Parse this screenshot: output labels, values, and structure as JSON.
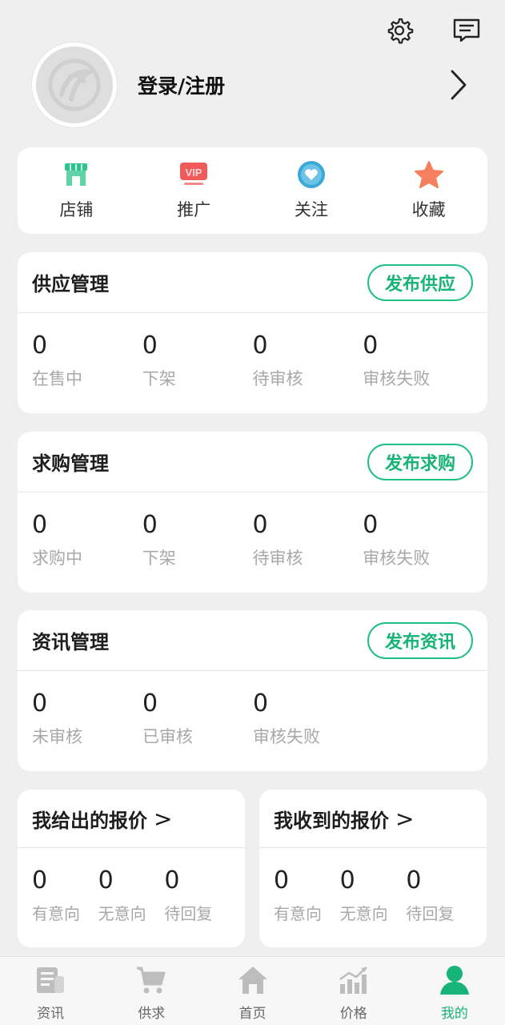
{
  "header": {
    "settings_icon": "gear-icon",
    "message_icon": "message-icon",
    "login_label": "登录/注册"
  },
  "quick_actions": [
    {
      "label": "店铺",
      "icon": "store-icon",
      "color": "#2dc48d"
    },
    {
      "label": "推广",
      "icon": "vip-icon",
      "color": "#f05a5a"
    },
    {
      "label": "关注",
      "icon": "heart-icon",
      "color": "#3aa9d8"
    },
    {
      "label": "收藏",
      "icon": "star-icon",
      "color": "#f4805f"
    }
  ],
  "supply": {
    "title": "供应管理",
    "button": "发布供应",
    "stats": [
      {
        "value": "0",
        "label": "在售中"
      },
      {
        "value": "0",
        "label": "下架"
      },
      {
        "value": "0",
        "label": "待审核"
      },
      {
        "value": "0",
        "label": "审核失败"
      }
    ]
  },
  "demand": {
    "title": "求购管理",
    "button": "发布求购",
    "stats": [
      {
        "value": "0",
        "label": "求购中"
      },
      {
        "value": "0",
        "label": "下架"
      },
      {
        "value": "0",
        "label": "待审核"
      },
      {
        "value": "0",
        "label": "审核失败"
      }
    ]
  },
  "news": {
    "title": "资讯管理",
    "button": "发布资讯",
    "stats": [
      {
        "value": "0",
        "label": "未审核"
      },
      {
        "value": "0",
        "label": "已审核"
      },
      {
        "value": "0",
        "label": "审核失败"
      }
    ]
  },
  "quotes_given": {
    "title": "我给出的报价",
    "arrow": ">",
    "stats": [
      {
        "value": "0",
        "label": "有意向"
      },
      {
        "value": "0",
        "label": "无意向"
      },
      {
        "value": "0",
        "label": "待回复"
      }
    ]
  },
  "quotes_received": {
    "title": "我收到的报价",
    "arrow": ">",
    "stats": [
      {
        "value": "0",
        "label": "有意向"
      },
      {
        "value": "0",
        "label": "无意向"
      },
      {
        "value": "0",
        "label": "待回复"
      }
    ]
  },
  "tabs": [
    {
      "label": "资讯",
      "icon": "news-icon"
    },
    {
      "label": "供求",
      "icon": "cart-icon"
    },
    {
      "label": "首页",
      "icon": "home-icon"
    },
    {
      "label": "价格",
      "icon": "price-chart-icon"
    },
    {
      "label": "我的",
      "icon": "user-icon",
      "active": true
    }
  ],
  "colors": {
    "accent": "#17b377",
    "background": "#efefef",
    "card": "#ffffff",
    "muted_text": "#a8a8a8"
  }
}
